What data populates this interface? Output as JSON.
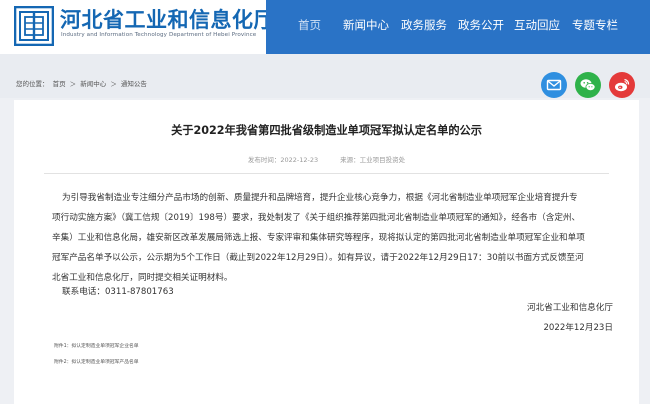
{
  "header": {
    "title": "河北省工业和信息化厅",
    "subtitle": "Industry and Information Technology Department of Hebei Province",
    "nav": [
      "首页",
      "新闻中心",
      "政务服务",
      "政务公开",
      "互动回应",
      "专题专栏"
    ]
  },
  "breadcrumb": {
    "label": "您的位置：",
    "items": [
      "首页",
      "新闻中心",
      "通知公告"
    ],
    "separator": "＞"
  },
  "social": [
    {
      "name": "email-icon",
      "color": "#2f8fe0"
    },
    {
      "name": "wechat-icon",
      "color": "#2fb24a"
    },
    {
      "name": "weibo-icon",
      "color": "#e43a3a"
    }
  ],
  "article": {
    "title": "关于2022年我省第四批省级制造业单项冠军拟认定名单的公示",
    "publish_date": "发布时间：2022-12-23",
    "source": "来源：工业项目投资处",
    "paragraph_lines": [
      "为引导我省制造业专注细分产品市场的创新、质量提升和品牌培育，提升企业核心竞争力，根据《河北省制造业单项冠军企业培育提升专",
      "项行动实施方案》（冀工信规〔2019〕198号）要求，我处制发了《关于组织推荐第四批河北省制造业单项冠军的通知》，经各市（含定州、",
      "辛集）工业和信息化局，雄安新区改革发展局筛选上报、专家评审和集体研究等程序，现将拟认定的第四批河北省制造业单项冠军企业和单项",
      "冠军产品名单予以公示，公示期为5个工作日（截止到2022年12月29日）。如有异议，请于2022年12月29日17：30前以书面方式反馈至河",
      "北省工业和信息化厅，同时提交相关证明材料。"
    ],
    "contact": "联系电话：0311-87801763",
    "signature_org": "河北省工业和信息化厅",
    "signature_date": "2022年12月23日",
    "attachments": [
      "附件1：拟认定制造业单项冠军企业名单",
      "附件2：拟认定制造业单项冠军产品名单"
    ]
  }
}
